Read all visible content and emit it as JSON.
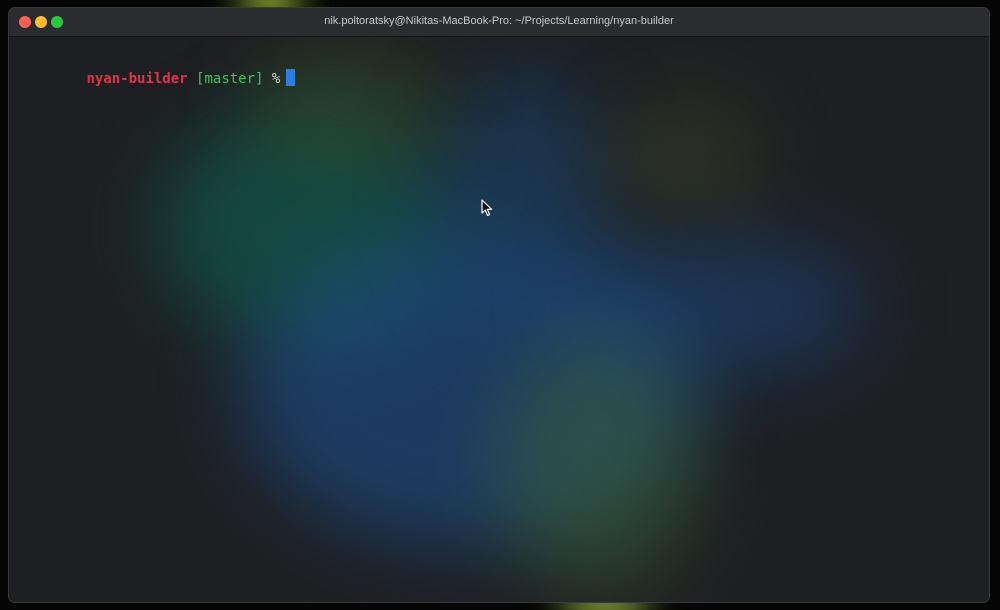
{
  "window": {
    "title": "nik.poltoratsky@Nikitas-MacBook-Pro: ~/Projects/Learning/nyan-builder"
  },
  "traffic_lights": {
    "close_color": "#fe5f57",
    "minimize_color": "#febc2e",
    "zoom_color": "#28c840"
  },
  "terminal": {
    "prompt": {
      "directory": "nyan-builder",
      "branch": "[master]",
      "symbol": "%"
    },
    "colors": {
      "directory": "#e0344a",
      "branch": "#3fc45a",
      "cursor": "#2a7fe0",
      "background": "#1e1f22"
    }
  },
  "icons": {
    "pointer": "mouse-pointer-icon"
  }
}
